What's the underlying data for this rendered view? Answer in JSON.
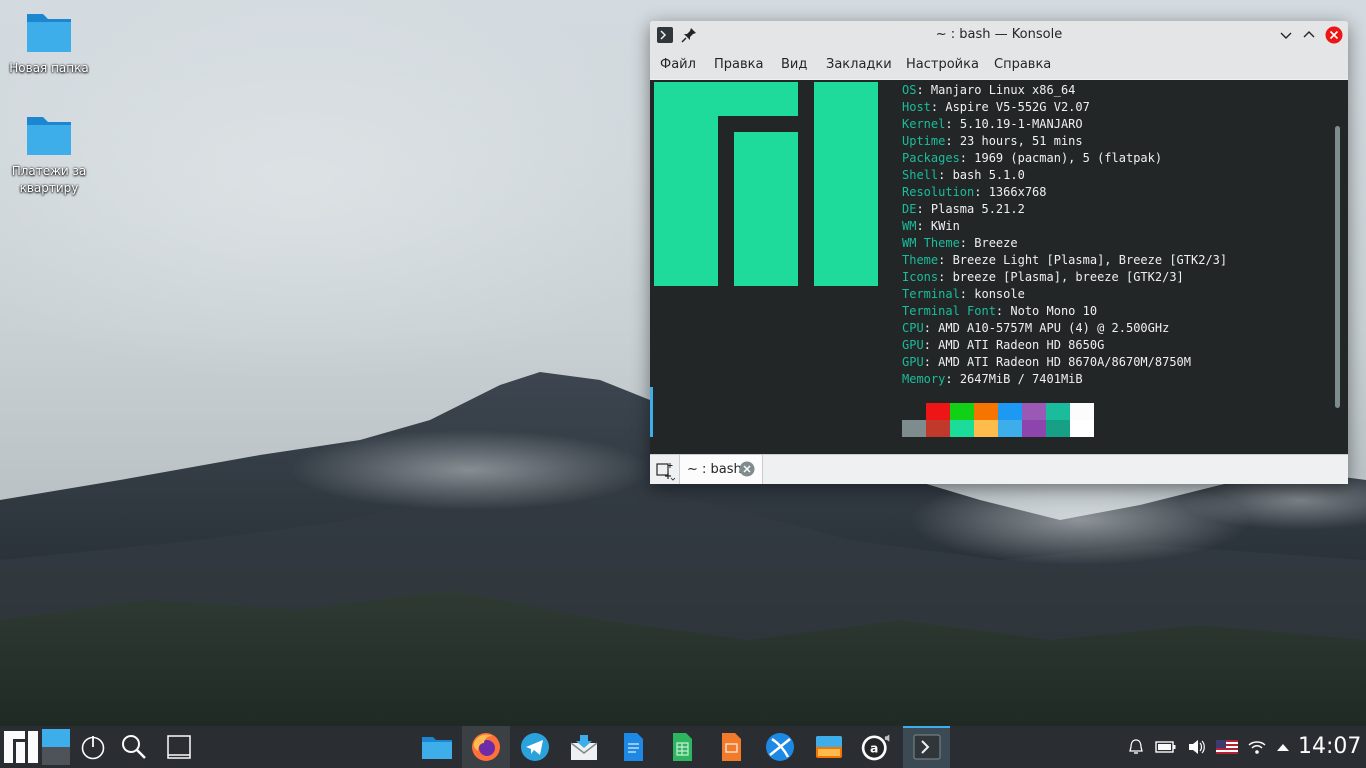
{
  "desktop": {
    "icons": [
      {
        "label": "Новая папка"
      },
      {
        "label": "Платежи за квартиру"
      }
    ]
  },
  "window": {
    "title": "~ : bash — Konsole",
    "menu": [
      "Файл",
      "Правка",
      "Вид",
      "Закладки",
      "Настройка",
      "Справка"
    ],
    "tab_label": "~ : bash"
  },
  "terminal": {
    "info": [
      {
        "key": "OS",
        "value": "Manjaro Linux x86_64"
      },
      {
        "key": "Host",
        "value": "Aspire V5-552G V2.07"
      },
      {
        "key": "Kernel",
        "value": "5.10.19-1-MANJARO"
      },
      {
        "key": "Uptime",
        "value": "23 hours, 51 mins"
      },
      {
        "key": "Packages",
        "value": "1969 (pacman), 5 (flatpak)"
      },
      {
        "key": "Shell",
        "value": "bash 5.1.0"
      },
      {
        "key": "Resolution",
        "value": "1366x768"
      },
      {
        "key": "DE",
        "value": "Plasma 5.21.2"
      },
      {
        "key": "WM",
        "value": "KWin"
      },
      {
        "key": "WM Theme",
        "value": "Breeze"
      },
      {
        "key": "Theme",
        "value": "Breeze Light [Plasma], Breeze [GTK2/3]"
      },
      {
        "key": "Icons",
        "value": "breeze [Plasma], breeze [GTK2/3]"
      },
      {
        "key": "Terminal",
        "value": "konsole"
      },
      {
        "key": "Terminal Font",
        "value": "Noto Mono 10"
      },
      {
        "key": "CPU",
        "value": "AMD A10-5757M APU (4) @ 2.500GHz"
      },
      {
        "key": "GPU",
        "value": "AMD ATI Radeon HD 8650G"
      },
      {
        "key": "GPU",
        "value": "AMD ATI Radeon HD 8670A/8670M/8750M"
      },
      {
        "key": "Memory",
        "value": "2647MiB / 7401MiB"
      }
    ],
    "palette_top": [
      "#232627",
      "#ed1515",
      "#11d116",
      "#f67400",
      "#1d99f3",
      "#9b59b6",
      "#1abc9c",
      "#fcfcfc"
    ],
    "palette_bottom": [
      "#7f8c8d",
      "#c0392b",
      "#1cdc9a",
      "#fdbc4b",
      "#3daee9",
      "#8e44ad",
      "#16a085",
      "#ffffff"
    ],
    "logo_color": "#1edb9b"
  },
  "taskbar": {
    "clock": "14:07",
    "pinned": [
      "file-manager",
      "firefox",
      "telegram",
      "mail-client",
      "writer-document",
      "spreadsheet",
      "presentation",
      "browser-web",
      "settings-window",
      "audio-app",
      "konsole"
    ]
  }
}
